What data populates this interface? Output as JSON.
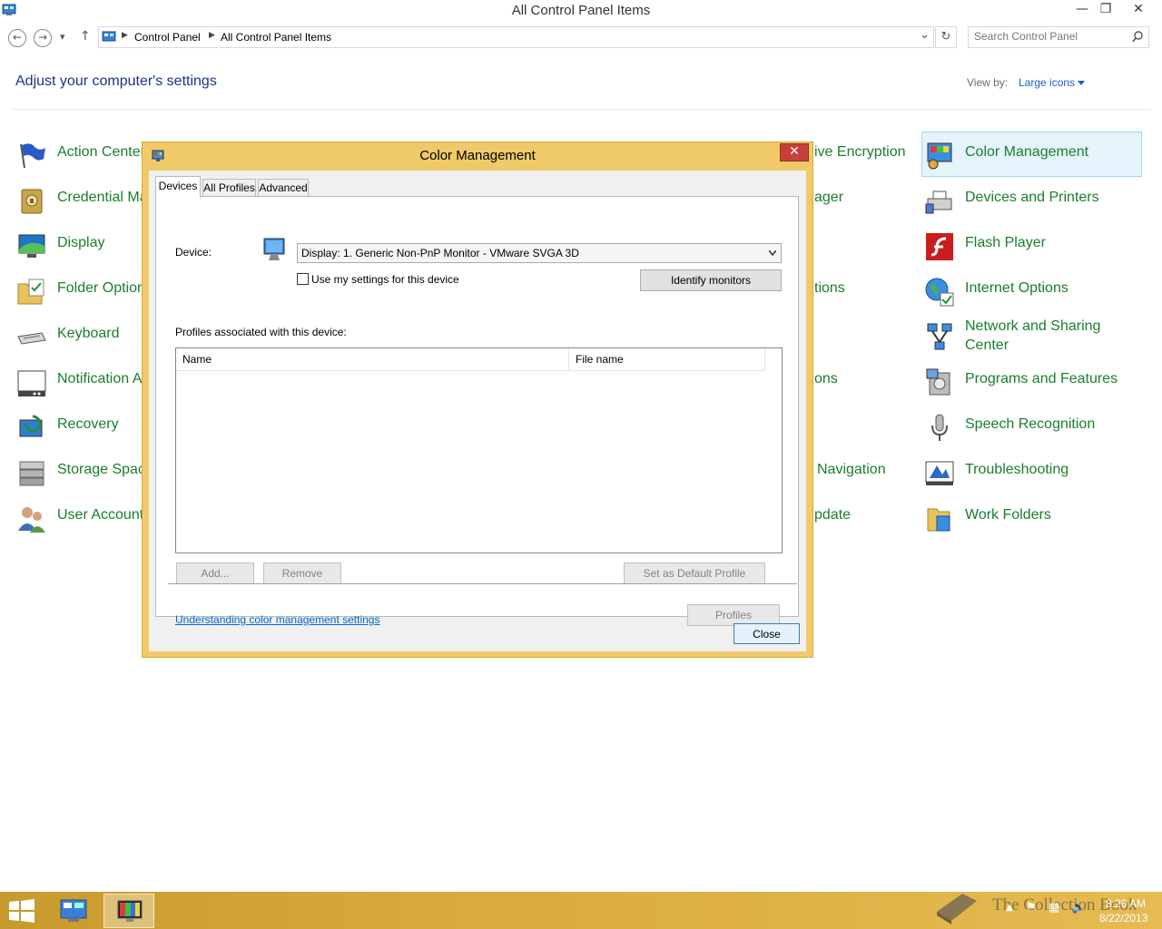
{
  "window": {
    "title": "All Control Panel Items",
    "min_glyph": "—",
    "max_glyph": "❐",
    "close_glyph": "✕"
  },
  "address": {
    "back_glyph": "←",
    "forward_glyph": "→",
    "recent_glyph": "▾",
    "up_glyph": "↑",
    "breadcrumbs": [
      "Control Panel",
      "All Control Panel Items"
    ],
    "dropdown_glyph": "⌄",
    "refresh_glyph": "↻",
    "search_placeholder": "Search Control Panel"
  },
  "header": {
    "title": "Adjust your computer's settings",
    "view_by_label": "View by:",
    "view_by_value": "Large icons"
  },
  "items": {
    "action_center": "Action Center",
    "credential_manager": "Credential Ma",
    "display": "Display",
    "folder_options": "Folder Option",
    "keyboard": "Keyboard",
    "notification_area": "Notification A",
    "recovery": "Recovery",
    "storage_spaces": "Storage Space",
    "user_accounts": "User Accounts",
    "bitlocker": "ive Encryption",
    "device_manager": "ager",
    "indexing_options": "tions",
    "power_options": "ons",
    "taskbar_navigation": "Navigation",
    "windows_update": "pdate",
    "color_management": "Color Management",
    "devices_printers": "Devices and Printers",
    "flash_player": "Flash Player",
    "internet_options": "Internet Options",
    "network_sharing": "Network and Sharing Center",
    "programs_features": "Programs and Features",
    "speech_recognition": "Speech Recognition",
    "troubleshooting": "Troubleshooting",
    "work_folders": "Work Folders"
  },
  "dialog": {
    "title": "Color Management",
    "close_glyph": "✕",
    "tabs": [
      "Devices",
      "All Profiles",
      "Advanced"
    ],
    "device_label": "Device:",
    "device_value": "Display: 1. Generic Non-PnP Monitor - VMware SVGA 3D",
    "use_settings_label": "Use my settings for this device",
    "identify_button": "Identify monitors",
    "profiles_label": "Profiles associated with this device:",
    "columns": [
      "Name",
      "File name"
    ],
    "add_button": "Add...",
    "remove_button": "Remove",
    "set_default_button": "Set as Default Profile",
    "understanding_link": "Understanding color management settings",
    "profiles_button": "Profiles",
    "close_button": "Close"
  },
  "taskbar": {
    "watermark": "The Collection Book",
    "time": "8:26 AM",
    "date": "8/22/2013"
  },
  "colors": {
    "accent_gold": "#f0ca6a",
    "link_green": "#1a7e2c",
    "heading_blue": "#1e3287",
    "close_red": "#c7413a"
  }
}
